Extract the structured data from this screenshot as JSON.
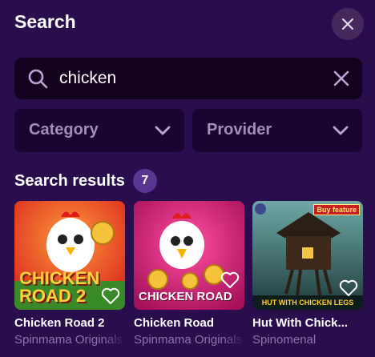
{
  "header": {
    "title": "Search",
    "close_icon": "close-icon"
  },
  "search": {
    "value": "chicken",
    "placeholder": "",
    "search_icon": "search-icon",
    "clear_icon": "close-icon"
  },
  "filters": [
    {
      "label": "Category",
      "icon": "chevron-down-icon"
    },
    {
      "label": "Provider",
      "icon": "chevron-down-icon"
    }
  ],
  "results": {
    "title": "Search results",
    "count": "7",
    "games": [
      {
        "name": "Chicken Road 2",
        "provider": "Spinmama Originals",
        "art_text": "CHICKEN ROAD 2"
      },
      {
        "name": "Chicken Road",
        "provider": "Spinmama Originals",
        "art_text": "CHICKEN ROAD"
      },
      {
        "name": "Hut With Chick...",
        "provider": "Spinomenal",
        "art_text": "HUT WITH CHICKEN LEGS",
        "badge": "Buy feature"
      }
    ]
  },
  "colors": {
    "background": "#2a0d4d",
    "input_bg": "#14031f",
    "filter_bg": "#1a0530",
    "badge_bg": "#5a3591",
    "muted_text": "#a48cbf"
  }
}
